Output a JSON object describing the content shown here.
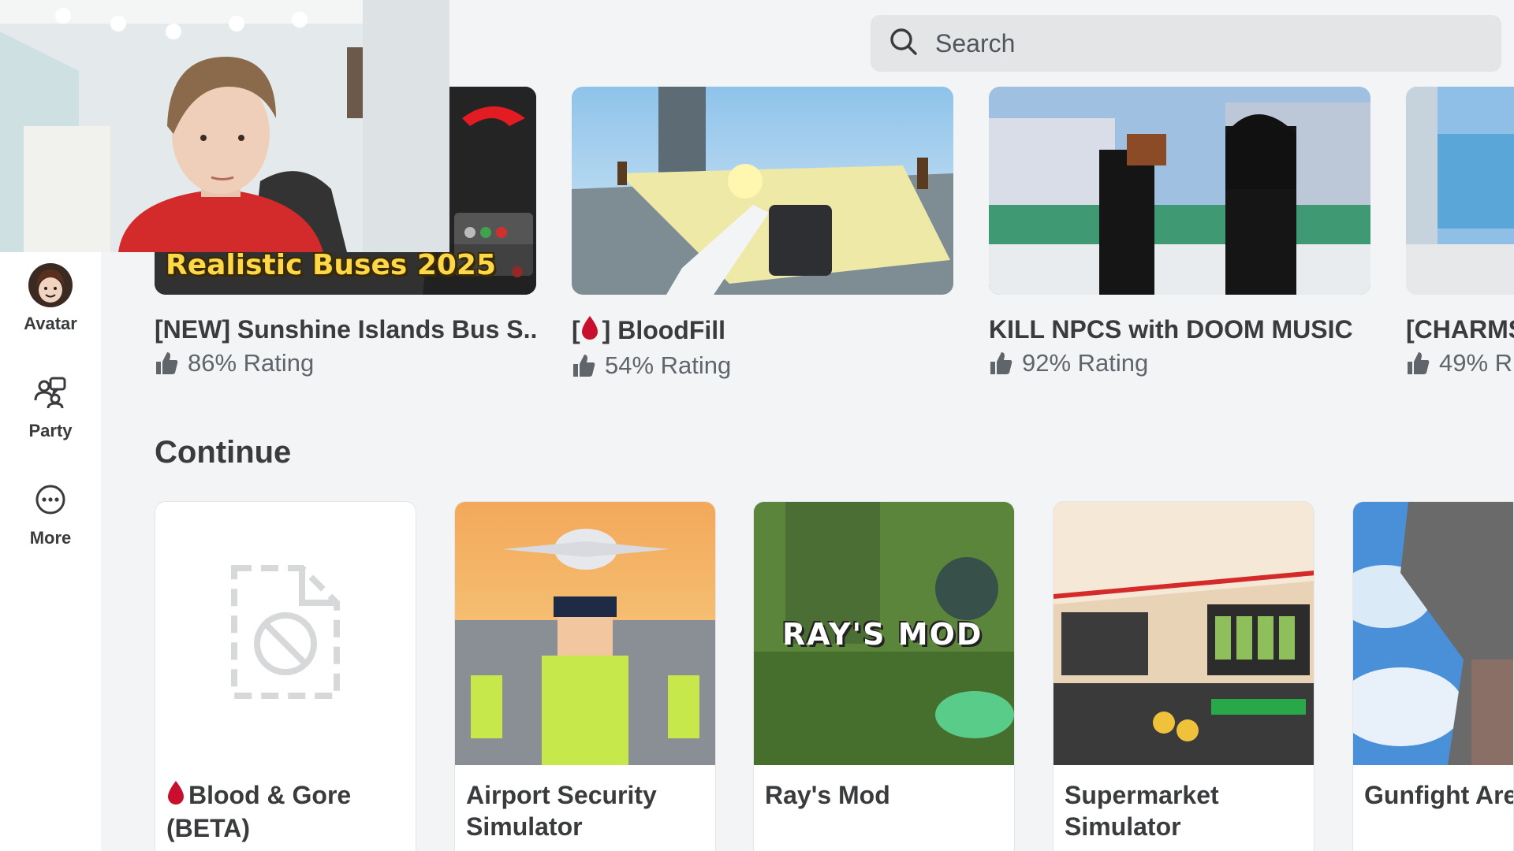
{
  "search": {
    "placeholder": "Search"
  },
  "sidebar": {
    "items": [
      {
        "label": "Avatar",
        "icon": "avatar-icon"
      },
      {
        "label": "Party",
        "icon": "party-icon"
      },
      {
        "label": "More",
        "icon": "more-icon"
      }
    ]
  },
  "recommended": [
    {
      "title": "[NEW] Sunshine Islands Bus S...",
      "rating": "86% Rating",
      "thumb_text": "Realistic Buses 2025"
    },
    {
      "title_prefix": "[",
      "title_suffix": "] BloodFill",
      "rating": "54% Rating"
    },
    {
      "title": "KILL NPCS with DOOM MUSIC",
      "rating": "92% Rating"
    },
    {
      "title": "[CHARMS",
      "rating": "49% R"
    }
  ],
  "continue_section": {
    "title": "Continue",
    "items": [
      {
        "title": "Blood & Gore (BETA)",
        "thumb": "unavailable-icon"
      },
      {
        "title": "Airport Security Simulator"
      },
      {
        "title": "Ray's Mod",
        "thumb_text": "RAY'S MOD"
      },
      {
        "title": "Supermarket Simulator"
      },
      {
        "title": "Gunfight Are"
      }
    ]
  },
  "colors": {
    "background": "#f2f4f5",
    "sidebar": "#ffffff",
    "search_bg": "#e3e5e7",
    "blood_red": "#c8102e",
    "text_primary": "#393b3d",
    "text_secondary": "#60656b"
  }
}
